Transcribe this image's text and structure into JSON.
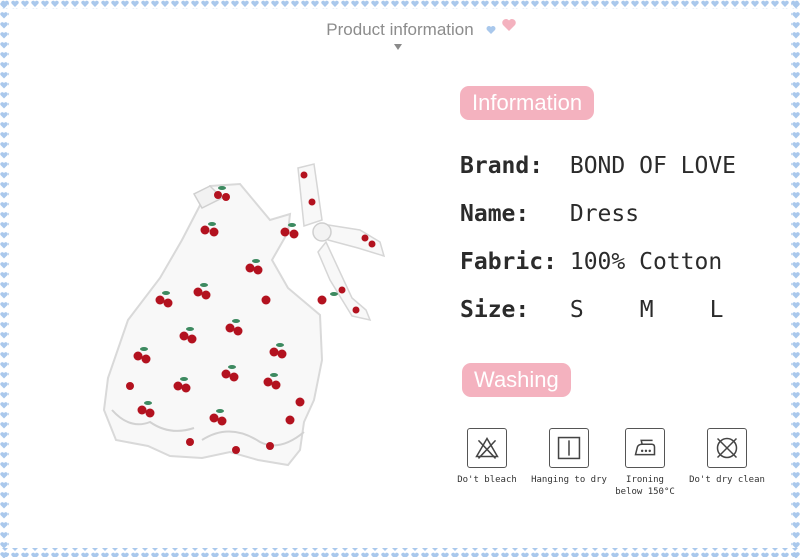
{
  "header": {
    "title": "Product information"
  },
  "info": {
    "section_title": "Information",
    "brand": {
      "label": "Brand:",
      "value": "BOND OF LOVE"
    },
    "name": {
      "label": "Name:",
      "value": "Dress"
    },
    "fabric": {
      "label": "Fabric:",
      "value": "100% Cotton"
    },
    "size": {
      "label": "Size:",
      "options": [
        "S",
        "M",
        "L"
      ]
    }
  },
  "washing": {
    "section_title": "Washing",
    "items": [
      {
        "icon": "no-bleach-icon",
        "label": "Do't bleach"
      },
      {
        "icon": "hanging-dry-icon",
        "label": "Hanging to dry"
      },
      {
        "icon": "iron-icon",
        "label_lines": [
          "Ironing",
          "below 150°C"
        ]
      },
      {
        "icon": "no-dry-clean-icon",
        "label": "Do't dry clean"
      }
    ]
  },
  "colors": {
    "accent_pink": "#f4b2bf",
    "border_blue": "#a9c8ec",
    "cherry_red": "#b3121f",
    "leaf_green": "#3d8a60"
  }
}
